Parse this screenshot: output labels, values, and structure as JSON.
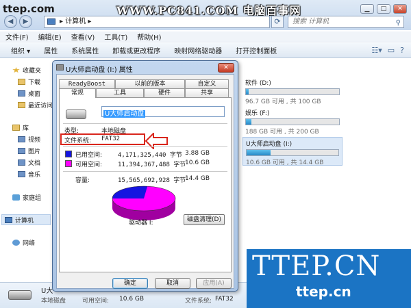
{
  "overlay": {
    "ttep_top": "ttep.com",
    "site_banner": "WWW.PC841.COM 电脑百事网",
    "wm_big": "TTEP.CN",
    "wm_small": "ttep.cn"
  },
  "explorer": {
    "address": "计算机",
    "search_placeholder": "搜索 计算机",
    "menu": [
      "文件(F)",
      "编辑(E)",
      "查看(V)",
      "工具(T)",
      "帮助(H)"
    ],
    "toolbar": [
      "组织 ▾",
      "属性",
      "系统属性",
      "卸载或更改程序",
      "映射网络驱动器",
      "打开控制面板"
    ],
    "sidebar": [
      {
        "label": "收藏夹",
        "icon": "star-icon"
      },
      {
        "label": "下载",
        "icon": "folder-icon"
      },
      {
        "label": "桌面",
        "icon": "folder-icon"
      },
      {
        "label": "最近访问",
        "icon": "folder-icon"
      },
      {
        "label": "库",
        "icon": "library-icon"
      },
      {
        "label": "视频",
        "icon": "video-icon"
      },
      {
        "label": "图片",
        "icon": "picture-icon"
      },
      {
        "label": "文档",
        "icon": "document-icon"
      },
      {
        "label": "音乐",
        "icon": "music-icon"
      },
      {
        "label": "家庭组",
        "icon": "homegroup-icon"
      },
      {
        "label": "计算机",
        "icon": "computer-icon"
      },
      {
        "label": "网络",
        "icon": "network-icon"
      }
    ],
    "drives": [
      {
        "name": "软件 (D:)",
        "detail": "96.7 GB 可用 , 共 100 GB",
        "used_fraction": 0.03
      },
      {
        "name": "娱乐 (F:)",
        "detail": "188 GB 可用 , 共 200 GB",
        "used_fraction": 0.06
      },
      {
        "name": "U大师启动盘 (I:)",
        "detail": "10.6 GB 可用 , 共 14.4 GB",
        "used_fraction": 0.26
      }
    ],
    "details": {
      "name": "U大",
      "type": "本地磁盘",
      "free_label": "可用空间:",
      "free": "10.6 GB",
      "fs_label": "文件系统:",
      "fs": "FAT32"
    }
  },
  "dialog": {
    "title": "U大师启动盘 (I:) 属性",
    "tabs_row1": [
      "ReadyBoost",
      "以前的版本",
      "自定义"
    ],
    "tabs_row2": [
      "常规",
      "工具",
      "硬件",
      "共享"
    ],
    "volume_label": "U大师启动盘",
    "type_label": "类型:",
    "type_value": "本地磁盘",
    "fs_label": "文件系统:",
    "fs_value": "FAT32",
    "used_label": "已用空间:",
    "used_bytes": "4,171,325,440 字节",
    "used_size": "3.88 GB",
    "free_label": "可用空间:",
    "free_bytes": "11,394,367,488 字节",
    "free_size": "10.6 GB",
    "cap_label": "容量:",
    "cap_bytes": "15,565,692,928 字节",
    "cap_size": "14.4 GB",
    "used_fraction": 0.268,
    "drive_label": "驱动器 I:",
    "cleanup": "磁盘清理(D)",
    "ok": "确定",
    "cancel": "取消",
    "apply": "应用(A)",
    "colors": {
      "used": "#1515e0",
      "free": "#ff00ff",
      "highlight": "#d9261c"
    }
  }
}
